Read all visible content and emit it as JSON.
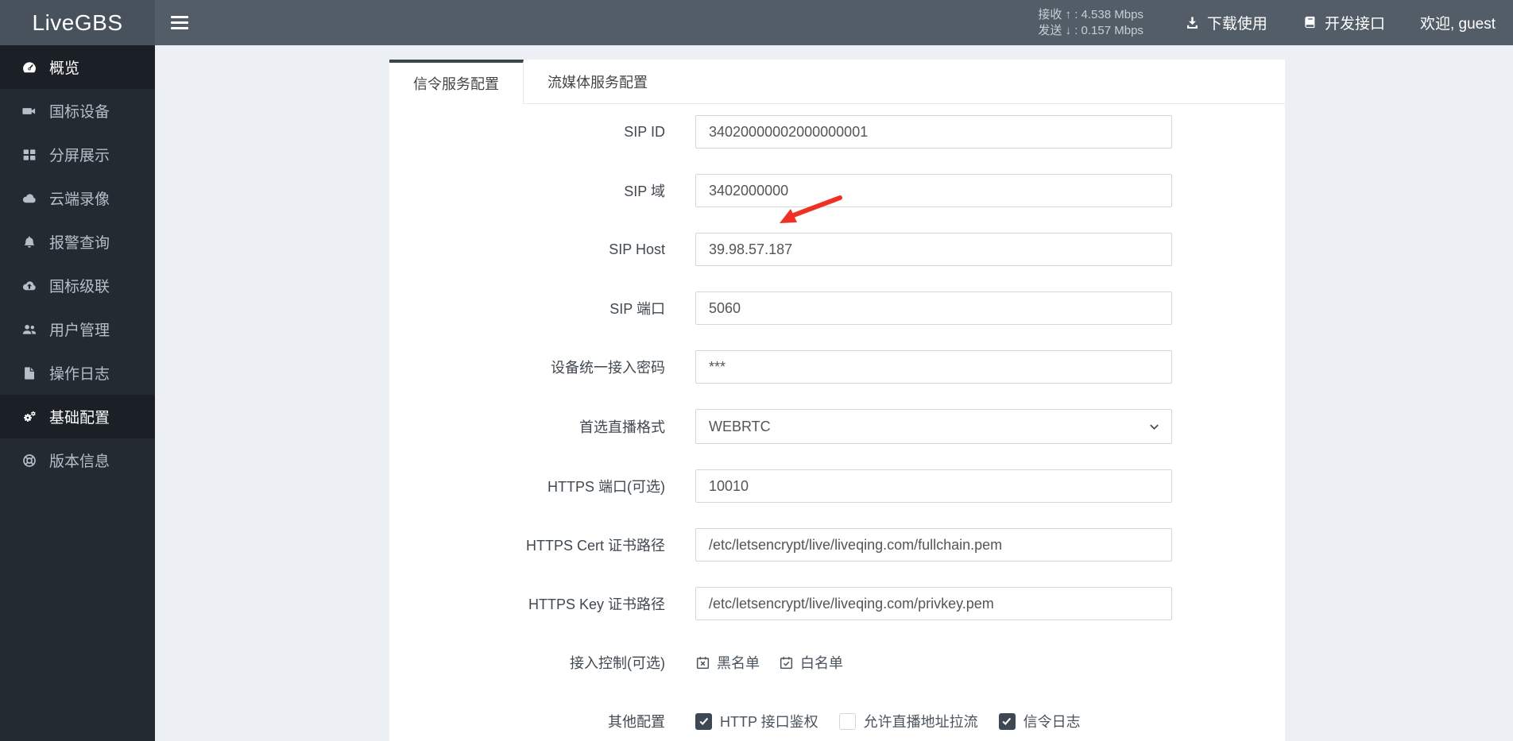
{
  "topbar": {
    "logo": "LiveGBS",
    "stats": [
      {
        "label": "接收",
        "direction": "up",
        "sep": ":",
        "value": "4.538 Mbps"
      },
      {
        "label": "发送",
        "direction": "down",
        "sep": ":",
        "value": "0.157 Mbps"
      }
    ],
    "menu": [
      {
        "label": "下载使用",
        "icon": "download-icon"
      },
      {
        "label": "开发接口",
        "icon": "book-icon"
      },
      {
        "label": "欢迎, guest"
      }
    ]
  },
  "sidebar": {
    "items": [
      {
        "label": "概览",
        "icon": "gauge-icon",
        "active": true
      },
      {
        "label": "国标设备",
        "icon": "video-camera-icon",
        "active": false
      },
      {
        "label": "分屏展示",
        "icon": "grid-icon",
        "active": false
      },
      {
        "label": "云端录像",
        "icon": "cloud-icon",
        "active": false
      },
      {
        "label": "报警查询",
        "icon": "bell-icon",
        "active": false
      },
      {
        "label": "国标级联",
        "icon": "cloud-upload-icon",
        "active": false
      },
      {
        "label": "用户管理",
        "icon": "users-icon",
        "active": false
      },
      {
        "label": "操作日志",
        "icon": "file-icon",
        "active": false
      },
      {
        "label": "基础配置",
        "icon": "gears-icon",
        "active": true
      },
      {
        "label": "版本信息",
        "icon": "life-ring-icon",
        "active": false
      }
    ]
  },
  "tabs": [
    {
      "label": "信令服务配置",
      "active": true
    },
    {
      "label": "流媒体服务配置",
      "active": false
    }
  ],
  "form": {
    "fields": [
      {
        "label": "SIP ID",
        "type": "input",
        "value": "34020000002000000001"
      },
      {
        "label": "SIP 域",
        "type": "input",
        "value": "3402000000"
      },
      {
        "label": "SIP Host",
        "type": "input",
        "value": "39.98.57.187"
      },
      {
        "label": "SIP 端口",
        "type": "input",
        "value": "5060"
      },
      {
        "label": "设备统一接入密码",
        "type": "input",
        "value": "***"
      },
      {
        "label": "首选直播格式",
        "type": "select",
        "value": "WEBRTC"
      },
      {
        "label": "HTTPS 端口(可选)",
        "type": "input",
        "value": "10010"
      },
      {
        "label": "HTTPS Cert 证书路径",
        "type": "input",
        "value": "/etc/letsencrypt/live/liveqing.com/fullchain.pem"
      },
      {
        "label": "HTTPS Key 证书路径",
        "type": "input",
        "value": "/etc/letsencrypt/live/liveqing.com/privkey.pem"
      }
    ],
    "access_control": {
      "label": "接入控制(可选)",
      "blacklist": "黑名单",
      "whitelist": "白名单"
    },
    "other": {
      "label": "其他配置",
      "checkboxes": [
        {
          "label": "HTTP 接口鉴权",
          "checked": true
        },
        {
          "label": "允许直播地址拉流",
          "checked": false
        },
        {
          "label": "信令日志",
          "checked": true
        }
      ]
    }
  },
  "colors": {
    "navbar": "#525D68",
    "sidebar": "#242A31",
    "sidebar_active": "#1A2025",
    "accent_dark": "#3A454E",
    "annotation_red": "#EE3124",
    "checkbox_checked": "#3D4852"
  }
}
